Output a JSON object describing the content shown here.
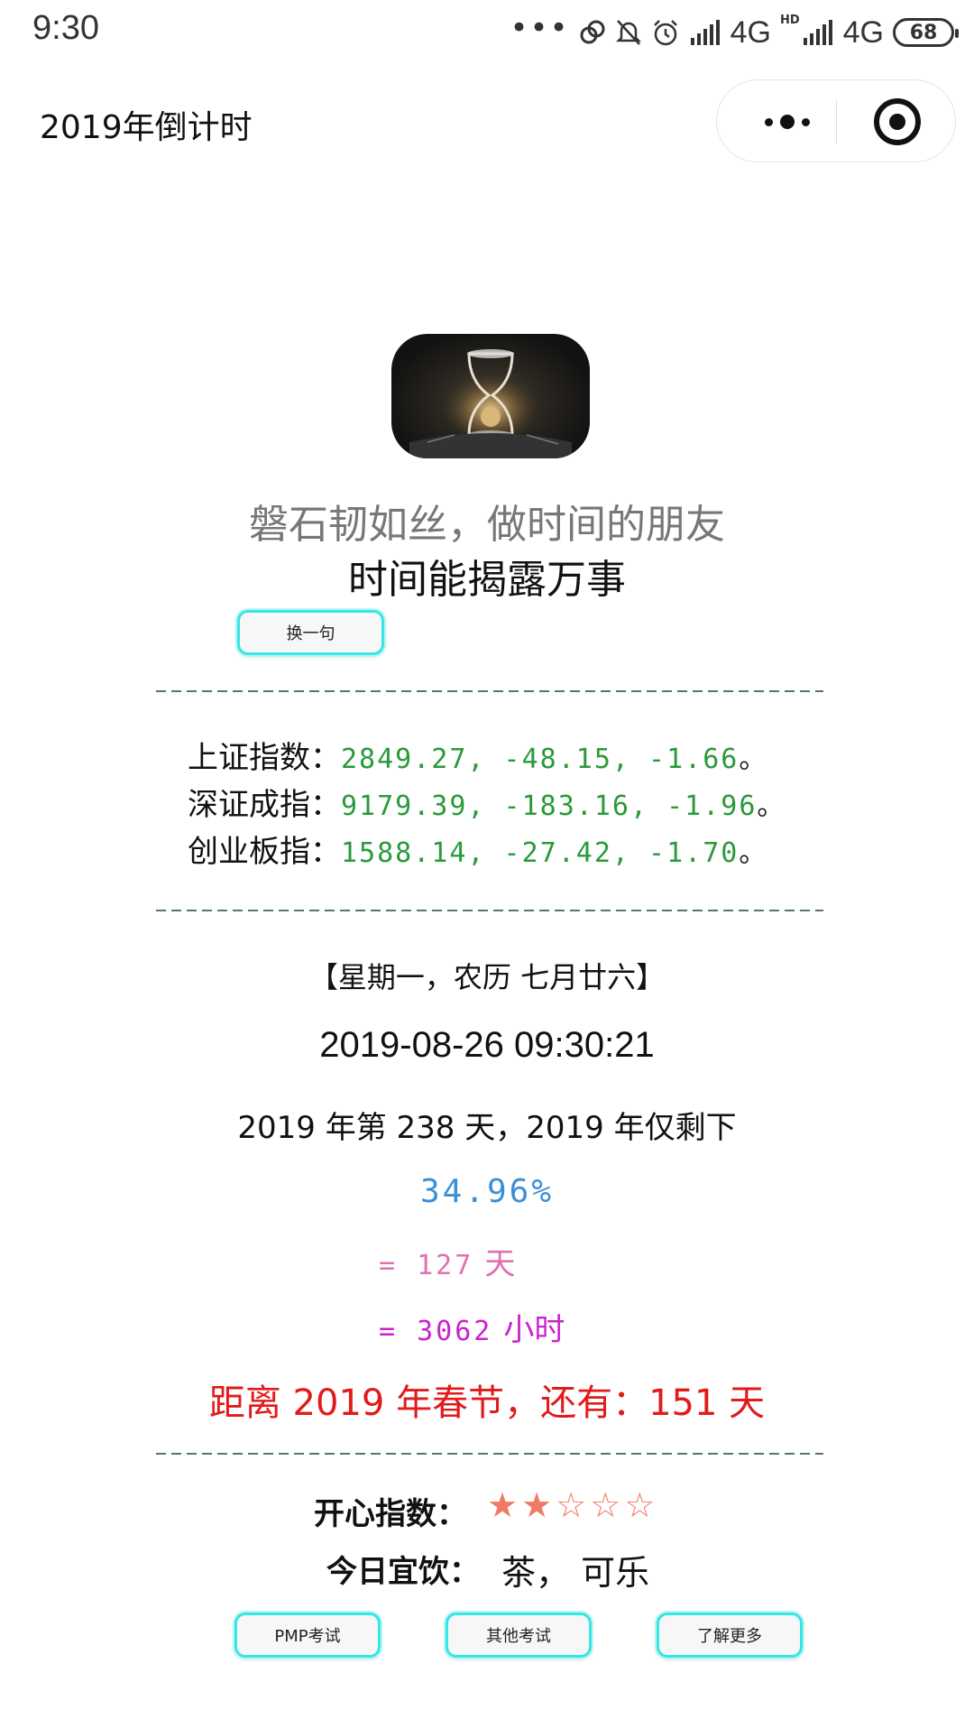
{
  "status_bar": {
    "time": "9:30",
    "network_1": "4G",
    "hd_badge": "HD",
    "network_2": "4G",
    "battery": "68",
    "icons": [
      "more-dots-icon",
      "link-icon",
      "mute-bell-icon",
      "alarm-icon",
      "signal-icon",
      "signal-icon",
      "battery-icon"
    ]
  },
  "nav": {
    "title": "2019年倒计时",
    "more_icon": "more-dots-icon",
    "close_icon": "target-close-icon"
  },
  "quote": {
    "line1": "磐石韧如丝，做时间的朋友",
    "line2": "时间能揭露万事",
    "change_button": "换一句"
  },
  "stocks": [
    {
      "label": "上证指数：",
      "values": "2849.27, -48.15, -1.66",
      "end": "。"
    },
    {
      "label": "深证成指：",
      "values": "9179.39, -183.16, -1.96",
      "end": "。"
    },
    {
      "label": "创业板指：",
      "values": "1588.14, -27.42, -1.70",
      "end": "。"
    }
  ],
  "date": {
    "weekday_line": "【星期一，农历 七月廿六】",
    "datetime": "2019-08-26 09:30:21",
    "dayinfo": "2019 年第 238 天，2019 年仅剩下",
    "percent": "34.96%",
    "days_prefix": "= 127",
    "days_unit": "天",
    "hours_prefix": "= 3062",
    "hours_unit": "小时",
    "spring_festival": "距离 2019 年春节，还有：151 天"
  },
  "happy": {
    "label": "开心指数：",
    "stars": "★★☆☆☆",
    "rating": 2,
    "max": 5
  },
  "drink": {
    "label": "今日宜饮：",
    "value": "茶， 可乐"
  },
  "buttons": {
    "pmp": "PMP考试",
    "other": "其他考试",
    "more": "了解更多"
  },
  "colors": {
    "accent_border": "#36e6e4",
    "stock_green": "#2a9a3a",
    "percent_blue": "#3a8fd6",
    "days_pink": "#e070b0",
    "hours_magenta": "#cc22cc",
    "spring_red": "#e21a1a",
    "star_color": "#f07a63"
  }
}
